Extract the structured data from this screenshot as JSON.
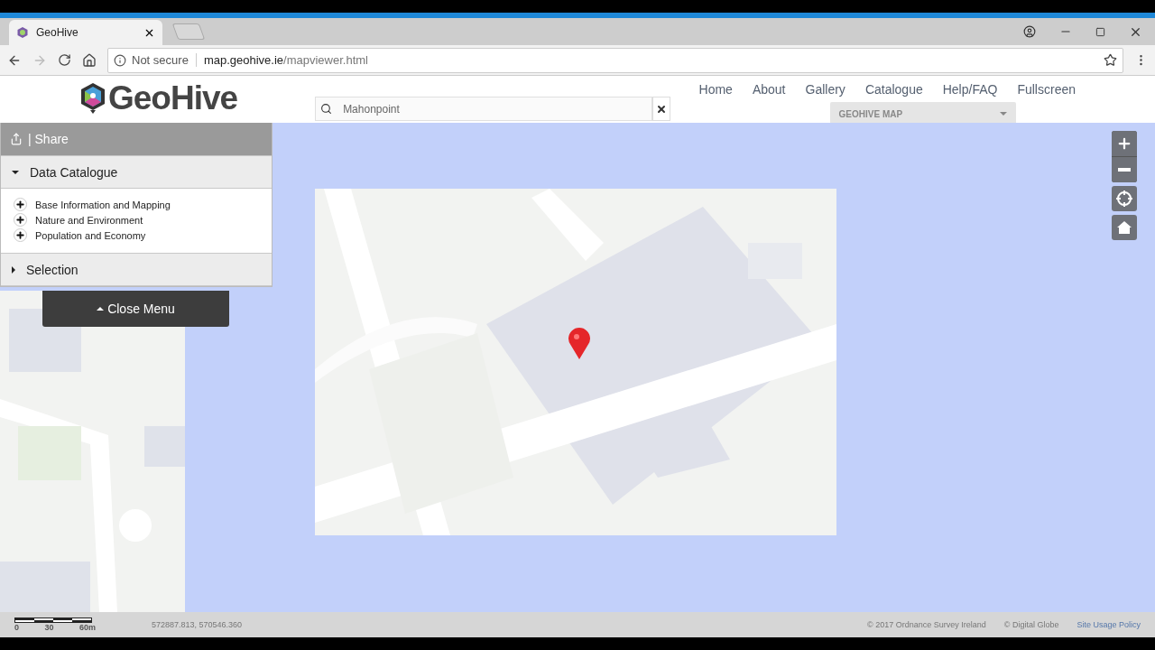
{
  "browser": {
    "tab_title": "GeoHive",
    "security": "Not secure",
    "url_host": "map.geohive.ie",
    "url_path": "/mapviewer.html"
  },
  "header": {
    "logo": "GeoHive",
    "search": {
      "value": "Mahonpoint"
    },
    "nav": [
      "Home",
      "About",
      "Gallery",
      "Catalogue",
      "Help/FAQ",
      "Fullscreen"
    ],
    "basemap_select": "GEOHIVE MAP"
  },
  "panel": {
    "share": "| Share",
    "sections": [
      {
        "title": "Data Catalogue",
        "expanded": true,
        "items": [
          "Base Information and Mapping",
          "Nature and Environment",
          "Population and Economy"
        ]
      },
      {
        "title": "Selection",
        "expanded": false
      }
    ],
    "close_button": "Close Menu"
  },
  "footer": {
    "scale_labels": [
      "0",
      "30",
      "60m"
    ],
    "coordinates": "572887.813, 570546.360",
    "credits": [
      "© 2017 Ordnance Survey Ireland",
      "© Digital Globe"
    ],
    "link": "Site Usage Policy"
  }
}
